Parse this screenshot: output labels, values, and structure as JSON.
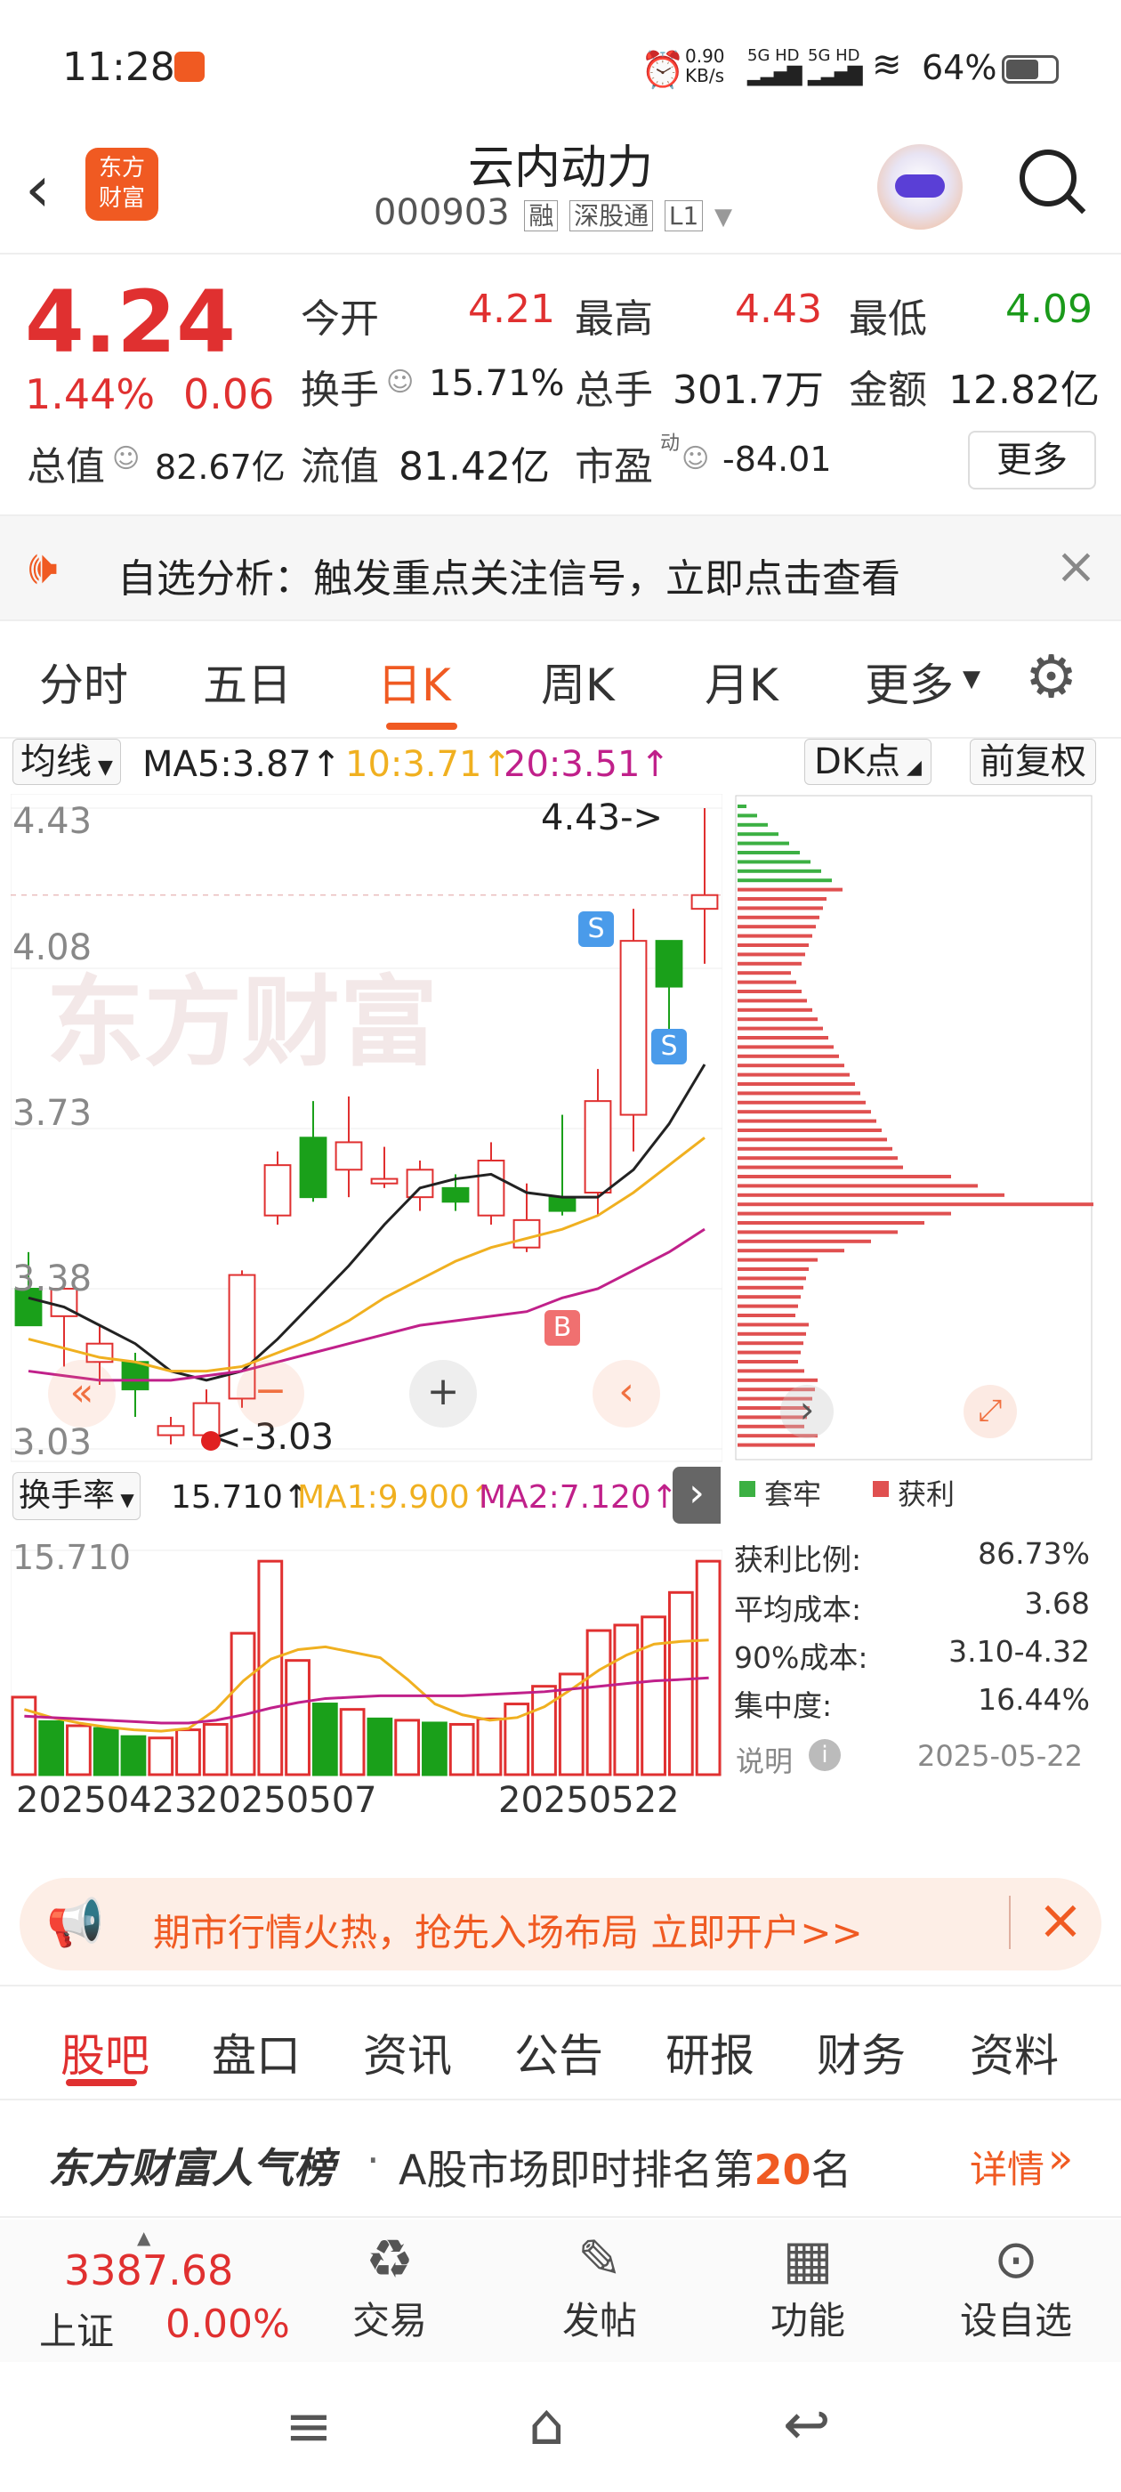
{
  "status": {
    "time": "11:28",
    "speed": "0.90\nKB/s",
    "net1": "5G HD",
    "net2": "5G HD",
    "battery": "64%"
  },
  "header": {
    "logo_line1": "东方",
    "logo_line2": "财富",
    "title": "云内动力",
    "code": "000903",
    "tags": [
      "融",
      "深股通",
      "L1"
    ]
  },
  "quote": {
    "price": "4.24",
    "pct": "1.44%",
    "chg": "0.06",
    "open_label": "今开",
    "open": "4.21",
    "high_label": "最高",
    "high": "4.43",
    "low_label": "最低",
    "low": "4.09",
    "turnover_label": "换手",
    "turnover": "15.71%",
    "volume_label": "总手",
    "volume": "301.7万",
    "amount_label": "金额",
    "amount": "12.82亿",
    "mktcap_label": "总值",
    "mktcap": "82.67亿",
    "float_label": "流值",
    "float": "81.42亿",
    "pe_label": "市盈",
    "pe_sup": "动",
    "pe": "-84.01",
    "more": "更多"
  },
  "banner": {
    "text": "自选分析：触发重点关注信号，立即点击查看"
  },
  "tabs": [
    "分时",
    "五日",
    "日K",
    "周K",
    "月K",
    "更多"
  ],
  "ma": {
    "select": "均线",
    "ma5": "MA5:3.87↑",
    "ma10": "10:3.71↑",
    "ma20": "20:3.51↑",
    "dk": "DK点",
    "fq": "前复权"
  },
  "kchart": {
    "y_labels": [
      "4.43",
      "4.08",
      "3.73",
      "3.38",
      "3.03"
    ],
    "high_tag": "4.43->",
    "low_tag": "<-3.03",
    "buy": "B",
    "sell": "S"
  },
  "colors": {
    "up": "#e03030",
    "down": "#1aa01a",
    "ma5": "#222222",
    "ma10": "#f0b020",
    "ma20": "#c0208a"
  },
  "chart_data": {
    "type": "candlestick",
    "dates": [
      "20250423",
      "",
      "",
      "",
      "",
      "20250507",
      "",
      "",
      "",
      "",
      "",
      "",
      "",
      "",
      "",
      "20250522"
    ],
    "ohlc": [
      [
        3.38,
        3.3,
        3.46,
        3.3
      ],
      [
        3.32,
        3.38,
        3.39,
        3.21
      ],
      [
        3.22,
        3.26,
        3.3,
        3.17
      ],
      [
        3.22,
        3.16,
        3.24,
        3.1
      ],
      [
        3.06,
        3.08,
        3.1,
        3.04
      ],
      [
        3.06,
        3.13,
        3.16,
        3.03
      ],
      [
        3.14,
        3.41,
        3.42,
        3.12
      ],
      [
        3.54,
        3.65,
        3.68,
        3.52
      ],
      [
        3.71,
        3.58,
        3.79,
        3.57
      ],
      [
        3.64,
        3.7,
        3.8,
        3.58
      ],
      [
        3.61,
        3.62,
        3.69,
        3.6
      ],
      [
        3.58,
        3.64,
        3.66,
        3.55
      ],
      [
        3.6,
        3.57,
        3.63,
        3.55
      ],
      [
        3.54,
        3.66,
        3.7,
        3.52
      ],
      [
        3.47,
        3.53,
        3.61,
        3.46
      ],
      [
        3.58,
        3.55,
        3.76,
        3.54
      ],
      [
        3.59,
        3.79,
        3.86,
        3.54
      ],
      [
        3.76,
        4.14,
        4.21,
        3.68
      ],
      [
        4.14,
        4.04,
        4.14,
        3.9
      ],
      [
        4.21,
        4.24,
        4.43,
        4.09
      ]
    ],
    "ma5": [
      3.36,
      3.34,
      3.3,
      3.26,
      3.2,
      3.18,
      3.2,
      3.27,
      3.35,
      3.43,
      3.52,
      3.6,
      3.62,
      3.63,
      3.59,
      3.58,
      3.58,
      3.64,
      3.74,
      3.87
    ],
    "ma10": [
      3.27,
      3.25,
      3.23,
      3.22,
      3.2,
      3.2,
      3.21,
      3.24,
      3.27,
      3.31,
      3.36,
      3.4,
      3.44,
      3.47,
      3.49,
      3.51,
      3.54,
      3.59,
      3.65,
      3.71
    ],
    "ma20": [
      3.2,
      3.19,
      3.18,
      3.18,
      3.18,
      3.19,
      3.2,
      3.22,
      3.24,
      3.26,
      3.28,
      3.3,
      3.31,
      3.32,
      3.33,
      3.36,
      3.38,
      3.42,
      3.46,
      3.51
    ],
    "ylim": [
      3.03,
      4.43
    ]
  },
  "turnover": {
    "select": "换手率",
    "val": "15.710↑",
    "ma1": "MA1:9.900↑",
    "ma2": "MA2:7.120↑",
    "ymax_label": "15.710",
    "values": [
      5.7,
      3.9,
      3.6,
      3.4,
      2.8,
      2.7,
      3.3,
      3.7,
      10.4,
      15.7,
      8.4,
      5.2,
      4.8,
      4.1,
      4.0,
      3.8,
      3.7,
      4.1,
      5.2,
      6.5,
      7.4,
      10.6,
      11.0,
      11.6,
      13.4,
      15.7
    ],
    "up": [
      true,
      false,
      true,
      false,
      false,
      true,
      true,
      true,
      true,
      true,
      true,
      false,
      true,
      false,
      true,
      false,
      true,
      true,
      true,
      true,
      true,
      true,
      true,
      true,
      true,
      true
    ]
  },
  "dates_axis": [
    "20250423",
    "20250507",
    "20250522"
  ],
  "chips": {
    "legend1": "套牢",
    "legend2": "获利",
    "profit_label": "获利比例:",
    "profit": "86.73%",
    "avg_label": "平均成本:",
    "avg": "3.68",
    "c90_label": "90%成本:",
    "c90": "3.10-4.32",
    "conc_label": "集中度:",
    "conc": "16.44%",
    "note": "说明",
    "date": "2025-05-22"
  },
  "promo": {
    "text": "期市行情火热，抢先入场布局 立即开户>>"
  },
  "subtabs": [
    "股吧",
    "盘口",
    "资讯",
    "公告",
    "研报",
    "财务",
    "资料"
  ],
  "popular": {
    "brand": "东方财富人气榜",
    "text": "A股市场即时排名第",
    "rank": "20",
    "suffix": "名",
    "more": "详情"
  },
  "bottom": {
    "index_val": "3387.68",
    "index_name": "上证",
    "index_pct": "0.00%",
    "b1": "交易",
    "b2": "发帖",
    "b3": "功能",
    "b4": "设自选"
  }
}
